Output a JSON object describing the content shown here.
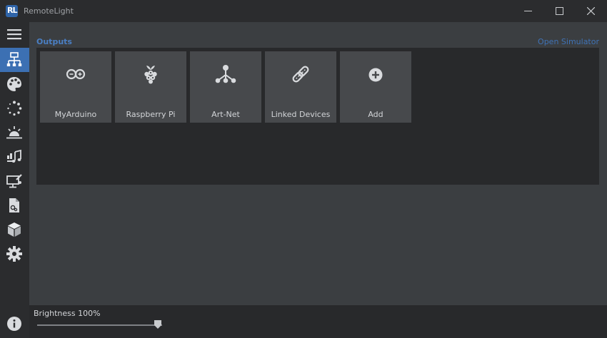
{
  "window": {
    "title": "RemoteLight",
    "icon_text": "RL",
    "accent_color": "#3c70b3"
  },
  "sidebar": {
    "items": [
      {
        "name": "menu-icon",
        "active": false
      },
      {
        "name": "outputs-icon",
        "active": true
      },
      {
        "name": "palette-icon",
        "active": false
      },
      {
        "name": "animations-icon",
        "active": false
      },
      {
        "name": "scenes-icon",
        "active": false
      },
      {
        "name": "music-sync-icon",
        "active": false
      },
      {
        "name": "screen-color-icon",
        "active": false
      },
      {
        "name": "scripts-icon",
        "active": false
      },
      {
        "name": "plugins-icon",
        "active": false
      },
      {
        "name": "settings-icon",
        "active": false
      },
      {
        "name": "info-icon",
        "active": false
      }
    ]
  },
  "outputs": {
    "title": "Outputs",
    "open_simulator": "Open Simulator",
    "tiles": [
      {
        "label": "MyArduino",
        "icon": "arduino-icon"
      },
      {
        "label": "Raspberry Pi",
        "icon": "raspberry-pi-icon"
      },
      {
        "label": "Art-Net",
        "icon": "network-icon"
      },
      {
        "label": "Linked Devices",
        "icon": "link-icon"
      },
      {
        "label": "Add",
        "icon": "add-icon"
      }
    ]
  },
  "brightness": {
    "label": "Brightness 100%",
    "value": 1.0
  }
}
